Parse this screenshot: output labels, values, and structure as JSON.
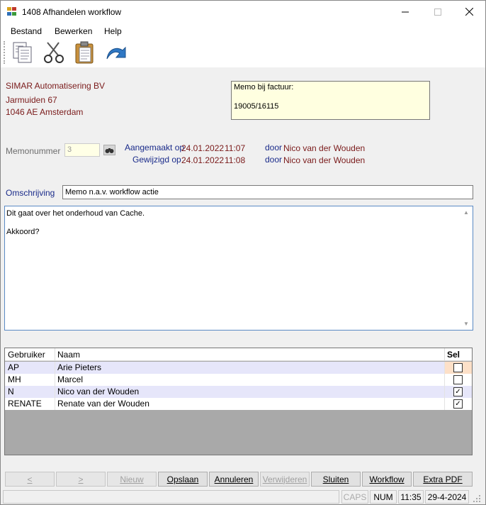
{
  "window": {
    "title": "1408 Afhandelen workflow"
  },
  "menu": {
    "items": [
      "Bestand",
      "Bewerken",
      "Help"
    ]
  },
  "toolbar": {
    "icons": [
      "copy-icon",
      "cut-icon",
      "paste-icon",
      "undo-icon"
    ]
  },
  "address": {
    "line1": "SIMAR Automatisering BV",
    "line2": "Jarmuiden 67",
    "line3": "1046 AE  Amsterdam"
  },
  "memo_factuur": {
    "label": "Memo bij factuur:",
    "value": "19005/16115"
  },
  "memonummer": {
    "label": "Memonummer",
    "value": "3"
  },
  "meta": {
    "created_label": "Aangemaakt op",
    "created_date": "24.01.2022",
    "created_time": "11:07",
    "changed_label": "Gewijzigd op",
    "changed_date": "24.01.2022",
    "changed_time": "11:08",
    "by_label": "door",
    "created_by": "Nico van der Wouden",
    "changed_by": "Nico van der Wouden"
  },
  "omschrijving": {
    "label": "Omschrijving",
    "value": "Memo n.a.v. workflow actie"
  },
  "memo_text": {
    "line1": "Dit gaat over het onderhoud van Cache.",
    "line2": "Akkoord?"
  },
  "grid": {
    "headers": [
      "Gebruiker",
      "Naam",
      "Sel"
    ],
    "rows": [
      {
        "user": "AP",
        "name": "Arie Pieters",
        "sel": false
      },
      {
        "user": "MH",
        "name": "Marcel",
        "sel": false
      },
      {
        "user": "N",
        "name": "Nico van der Wouden",
        "sel": true
      },
      {
        "user": "RENATE",
        "name": "Renate van der Wouden",
        "sel": true
      }
    ]
  },
  "buttons": {
    "prev": "<",
    "next": ">",
    "nieuw": "Nieuw",
    "opslaan": "Opslaan",
    "annuleren": "Annuleren",
    "verwijderen": "Verwijderen",
    "sluiten": "Sluiten",
    "workflow": "Workflow",
    "extra_pdf": "Extra PDF"
  },
  "status": {
    "caps": "CAPS",
    "num": "NUM",
    "time": "11:35",
    "date": "29-4-2024"
  },
  "colors": {
    "accent_label": "#1a2b8a",
    "value_text": "#7a1a1a",
    "memo_bg": "#ffffe0"
  }
}
